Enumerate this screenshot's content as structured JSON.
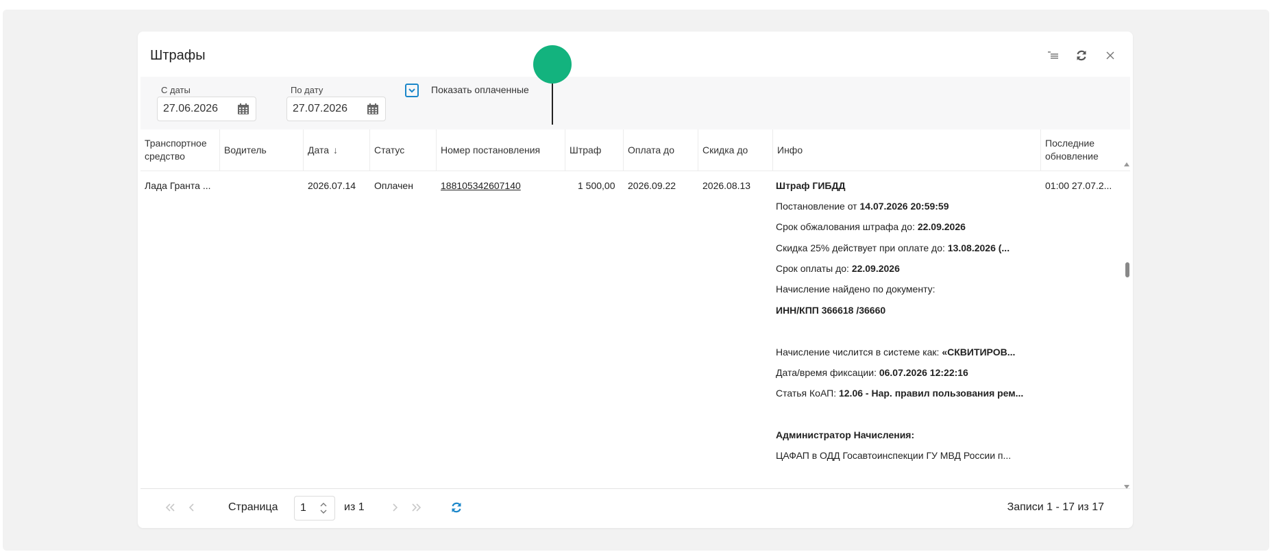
{
  "panel": {
    "title": "Штрафы"
  },
  "filters": {
    "from_label": "С даты",
    "from_value": "27.06.2026",
    "to_label": "По дату",
    "to_value": "27.07.2026",
    "show_paid_label": "Показать оплаченные",
    "show_paid_checked": true
  },
  "table": {
    "columns": [
      "Транспортное средство",
      "Водитель",
      "Дата",
      "Статус",
      "Номер постановления",
      "Штраф",
      "Оплата до",
      "Скидка до",
      "Инфо",
      "Последние обновление"
    ],
    "sort_column": "Дата",
    "rows": [
      {
        "vehicle": "Лада Гранта ...",
        "driver": "",
        "date": "2026.07.14",
        "status": "Оплачен",
        "resolution": "188105342607140",
        "fine": "1 500,00",
        "pay_until": "2026.09.22",
        "discount_until": "2026.08.13",
        "updated": "01:00 27.07.2...",
        "info": [
          {
            "label": "",
            "value": "Штраф ГИБДД"
          },
          {
            "label": "Постановление от ",
            "value": "14.07.2026 20:59:59"
          },
          {
            "label": "Срок обжалования штрафа до: ",
            "value": "22.09.2026"
          },
          {
            "label": "Скидка 25% действует при оплате до: ",
            "value": "13.08.2026 (..."
          },
          {
            "label": "Срок оплаты до: ",
            "value": "22.09.2026"
          },
          {
            "label": "Начисление найдено по документу:",
            "value": ""
          },
          {
            "label": "",
            "value": "ИНН/КПП 366618         /36660"
          },
          {
            "label": "",
            "value": ""
          },
          {
            "label": "Начисление числится в системе как: ",
            "value": "«СКВИТИРОВ..."
          },
          {
            "label": "Дата/время фиксации: ",
            "value": "06.07.2026 12:22:16"
          },
          {
            "label": "Статья КоАП: ",
            "value": "12.06 - Нар. правил пользования рем..."
          },
          {
            "label": "",
            "value": ""
          },
          {
            "label": "",
            "value": "Администратор Начисления:"
          },
          {
            "label": "ЦАФАП в ОДД Госавтоинспекции ГУ МВД России п...",
            "value": ""
          }
        ]
      }
    ]
  },
  "pager": {
    "page_label": "Страница",
    "page_value": "1",
    "of_label": "из 1",
    "records_label": "Записи 1 - 17 из 17"
  },
  "colors": {
    "accent": "#1a86c9",
    "marker": "#13b37e",
    "backdrop": "#f2f2f2"
  },
  "icons": {
    "header": [
      "column-settings-icon",
      "refresh-icon",
      "close-icon"
    ],
    "date": "calendar-icon",
    "checkbox": "chevron-down-icon",
    "pager": [
      "first-page-icon",
      "prev-page-icon",
      "next-page-icon",
      "last-page-icon",
      "refresh-icon"
    ]
  }
}
